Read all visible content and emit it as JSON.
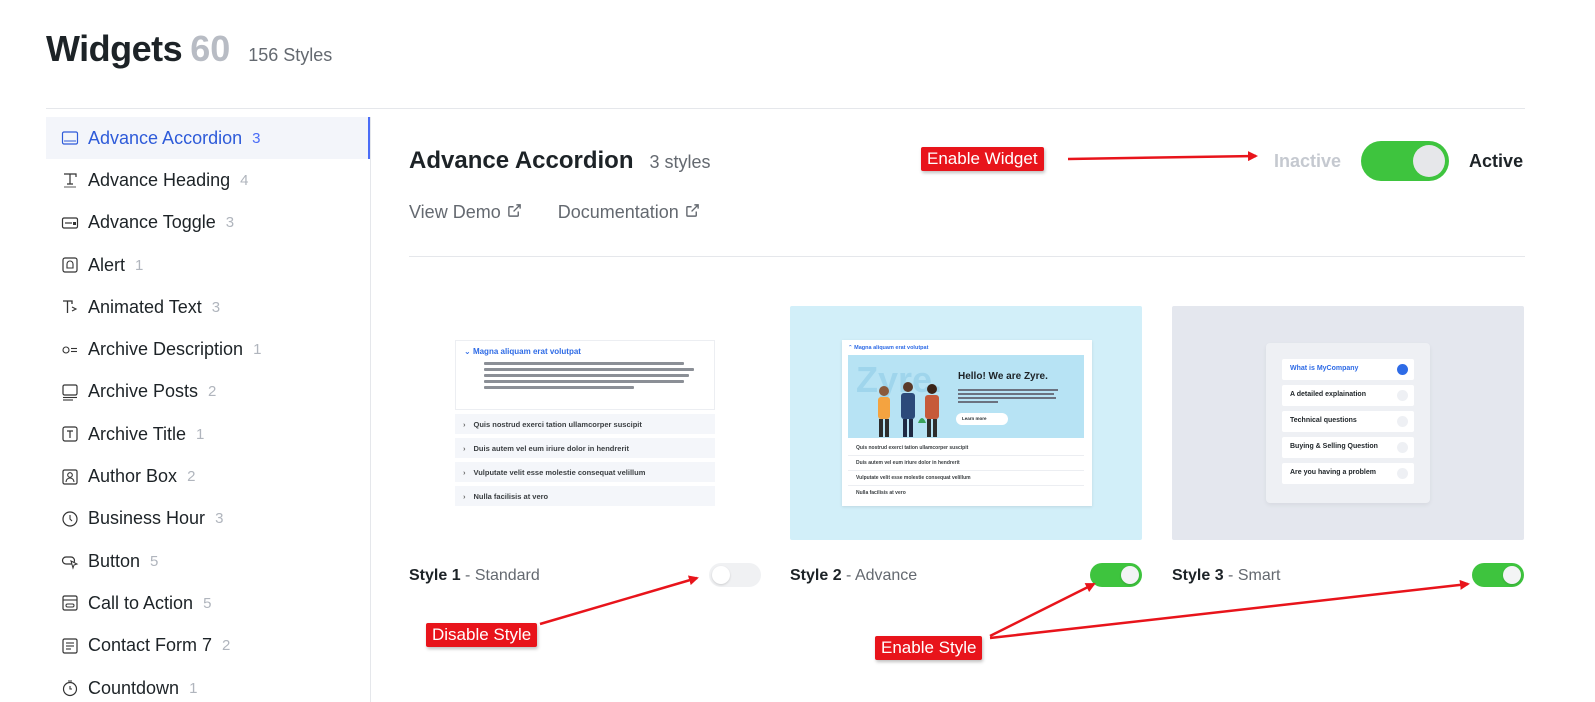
{
  "header": {
    "title": "Widgets",
    "count": "60",
    "styles": "156 Styles"
  },
  "sidebar": {
    "items": [
      {
        "label": "Advance Accordion",
        "count": "3",
        "icon": "accordion-icon"
      },
      {
        "label": "Advance Heading",
        "count": "4",
        "icon": "heading-icon"
      },
      {
        "label": "Advance Toggle",
        "count": "3",
        "icon": "toggle-icon"
      },
      {
        "label": "Alert",
        "count": "1",
        "icon": "alert-icon"
      },
      {
        "label": "Animated Text",
        "count": "3",
        "icon": "animated-text-icon"
      },
      {
        "label": "Archive Description",
        "count": "1",
        "icon": "archive-description-icon"
      },
      {
        "label": "Archive Posts",
        "count": "2",
        "icon": "archive-posts-icon"
      },
      {
        "label": "Archive Title",
        "count": "1",
        "icon": "archive-title-icon"
      },
      {
        "label": "Author Box",
        "count": "2",
        "icon": "author-box-icon"
      },
      {
        "label": "Business Hour",
        "count": "3",
        "icon": "business-hour-icon"
      },
      {
        "label": "Button",
        "count": "5",
        "icon": "button-icon"
      },
      {
        "label": "Call to Action",
        "count": "5",
        "icon": "call-to-action-icon"
      },
      {
        "label": "Contact Form 7",
        "count": "2",
        "icon": "contact-form-icon"
      },
      {
        "label": "Countdown",
        "count": "1",
        "icon": "countdown-icon"
      }
    ]
  },
  "widget": {
    "title": "Advance Accordion",
    "styles": "3 styles",
    "view_demo": "View Demo",
    "documentation": "Documentation",
    "inactive_label": "Inactive",
    "active_label": "Active",
    "enabled": true
  },
  "styles": [
    {
      "name": "Style 1",
      "type": "- Standard",
      "enabled": false
    },
    {
      "name": "Style 2",
      "type": "- Advance",
      "enabled": true
    },
    {
      "name": "Style 3",
      "type": "- Smart",
      "enabled": true
    }
  ],
  "thumb1": {
    "open_title": "Magna aliquam erat volutpat",
    "rows": [
      "Quis nostrud exerci tation ullamcorper suscipit",
      "Duis autem vel eum iriure dolor in hendrerit",
      "Vulputate velit esse molestie consequat velillum",
      "Nulla facilisis at vero"
    ]
  },
  "thumb2": {
    "head": "Magna aliquam erat volutpat",
    "brand": "Zyre.",
    "hello": "Hello! We are Zyre.",
    "button": "Learn more",
    "rows": [
      "Quis nostrud exerci tation ullamcorper suscipit",
      "Duis autem vel eum iriure dolor in hendrerit",
      "Vulputate velit esse molestie consequat velillum",
      "Nulla facilisis at vero"
    ]
  },
  "thumb3": {
    "items": [
      "What is MyCompany",
      "A detailed explaination",
      "Technical questions",
      "Buying & Selling Question",
      "Are you having a problem"
    ]
  },
  "annotations": {
    "enable_widget": "Enable Widget",
    "disable_style": "Disable Style",
    "enable_style": "Enable Style"
  },
  "colors": {
    "accent": "#4a6cf7",
    "toggle_on": "#3ec43e",
    "annotation": "#e8141b"
  }
}
